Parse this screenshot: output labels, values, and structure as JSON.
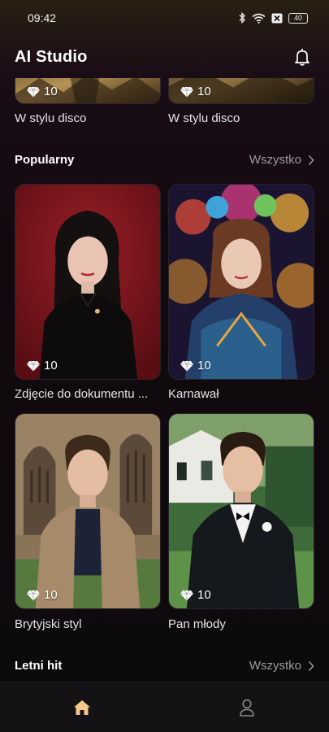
{
  "status_bar": {
    "time": "09:42",
    "battery": "40",
    "icons": [
      "bluetooth-icon",
      "wifi-icon",
      "sim-off-icon",
      "battery-icon"
    ]
  },
  "header": {
    "title": "AI Studio",
    "notifications_icon": "bell-icon"
  },
  "top_row": {
    "items": [
      {
        "cost": "10",
        "caption": "W stylu disco"
      },
      {
        "cost": "10",
        "caption": "W stylu disco"
      }
    ]
  },
  "popular": {
    "title": "Popularny",
    "see_all": "Wszystko",
    "items": [
      {
        "cost": "10",
        "caption": "Zdjęcie do dokumentu ..."
      },
      {
        "cost": "10",
        "caption": "Karnawał"
      },
      {
        "cost": "10",
        "caption": "Brytyjski styl"
      },
      {
        "cost": "10",
        "caption": "Pan młody"
      }
    ]
  },
  "summer": {
    "title": "Letni hit",
    "see_all": "Wszystko"
  },
  "bottom_nav": {
    "items": [
      {
        "icon": "home-icon",
        "active": true
      },
      {
        "icon": "profile-icon",
        "active": false
      }
    ]
  },
  "colors": {
    "accent": "#f5c98a",
    "background": "#0c0a0c",
    "muted": "#9c9c9c"
  }
}
